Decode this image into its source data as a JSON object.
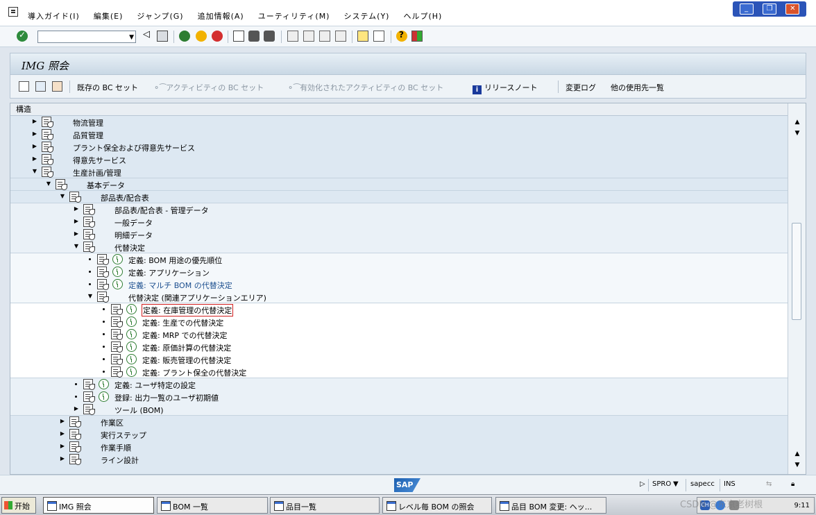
{
  "menu": {
    "items": [
      "導入ガイド(I)",
      "編集(E)",
      "ジャンプ(G)",
      "追加情報(A)",
      "ユーティリティ(M)",
      "システム(Y)",
      "ヘルプ(H)"
    ]
  },
  "window_controls": {
    "minimize": "_",
    "restore": "❐",
    "close": "✕"
  },
  "command_field": {
    "value": ""
  },
  "title": "IMG 照会",
  "app_toolbar": {
    "existing_bc_sets": "既存の BC セット",
    "activity_bc_sets": "アクティビティの BC セット",
    "active_activity_bc_sets": "有効化されたアクティビティの BC セット",
    "release_notes": "リリースノート",
    "change_log": "変更ログ",
    "where_used": "他の使用先一覧"
  },
  "tree": {
    "header": "構造",
    "rows": [
      {
        "label": "物流管理"
      },
      {
        "label": "品質管理"
      },
      {
        "label": "プラント保全および得意先サービス"
      },
      {
        "label": "得意先サービス"
      },
      {
        "label": "生産計画/管理"
      },
      {
        "label": "基本データ"
      },
      {
        "label": "部品表/配合表"
      },
      {
        "label": "部品表/配合表 - 管理データ"
      },
      {
        "label": "一般データ"
      },
      {
        "label": "明細データ"
      },
      {
        "label": "代替決定"
      },
      {
        "label": "定義: BOM 用途の優先順位"
      },
      {
        "label": "定義: アプリケーション"
      },
      {
        "label": "定義: マルチ BOM の代替決定"
      },
      {
        "label": "代替決定 (関連アプリケーションエリア)"
      },
      {
        "label": "定義: 在庫管理の代替決定"
      },
      {
        "label": "定義: 生産での代替決定"
      },
      {
        "label": "定義: MRP での代替決定"
      },
      {
        "label": "定義: 原価計算の代替決定"
      },
      {
        "label": "定義: 販売管理の代替決定"
      },
      {
        "label": "定義: プラント保全の代替決定"
      },
      {
        "label": "定義: ユーザ特定の設定"
      },
      {
        "label": "登録: 出力一覧のユーザ初期値"
      },
      {
        "label": "ツール (BOM)"
      },
      {
        "label": "作業区"
      },
      {
        "label": "実行ステップ"
      },
      {
        "label": "作業手順"
      },
      {
        "label": "ライン設計"
      }
    ]
  },
  "statusbar": {
    "sap_logo": "SAP",
    "transaction": "SPRO",
    "server": "sapecc",
    "mode": "INS"
  },
  "taskbar": {
    "start": "开始",
    "tasks": [
      "IMG 照会",
      "BOM 一覧",
      "品目一覧",
      "レベル毎 BOM の照会",
      "品目 BOM 変更: ヘッ..."
    ],
    "time": "9:11",
    "lang": "CH"
  },
  "watermark": "CSDN @东京老树根"
}
